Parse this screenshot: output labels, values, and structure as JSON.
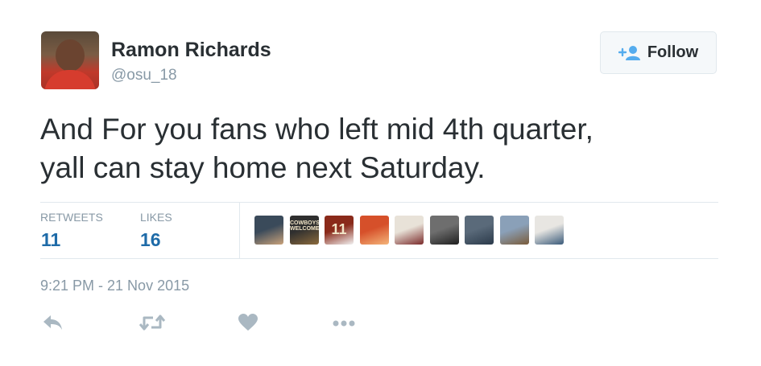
{
  "user": {
    "name": "Ramon Richards",
    "handle": "@osu_18"
  },
  "follow_button": {
    "label": "Follow"
  },
  "tweet": {
    "text_line1": "And For you fans who left mid 4th quarter,",
    "text_line2": "yall can stay home next Saturday."
  },
  "stats": {
    "retweets_label": "RETWEETS",
    "retweets_value": "11",
    "likes_label": "LIKES",
    "likes_value": "16"
  },
  "likers": [
    {
      "name": "liker-avatar-1",
      "colors": [
        "#3a4a5a",
        "#c9a27a"
      ]
    },
    {
      "name": "liker-avatar-2",
      "colors": [
        "#2f2f2f",
        "#8b6a3c"
      ],
      "text": "COWBOYS WELCOME"
    },
    {
      "name": "liker-avatar-3",
      "colors": [
        "#8a2a1a",
        "#f2f2f2"
      ],
      "text": "11"
    },
    {
      "name": "liker-avatar-4",
      "colors": [
        "#d6502a",
        "#f4b57a"
      ]
    },
    {
      "name": "liker-avatar-5",
      "colors": [
        "#e8e2d8",
        "#7a2a2a"
      ]
    },
    {
      "name": "liker-avatar-6",
      "colors": [
        "#6e6e6e",
        "#1f1f1f"
      ]
    },
    {
      "name": "liker-avatar-7",
      "colors": [
        "#5a6a7a",
        "#2b3a4a"
      ]
    },
    {
      "name": "liker-avatar-8",
      "colors": [
        "#8aa0b8",
        "#7a5c3a"
      ]
    },
    {
      "name": "liker-avatar-9",
      "colors": [
        "#e8e6e2",
        "#3a5a7a"
      ]
    }
  ],
  "timestamp": "9:21 PM - 21 Nov 2015",
  "icons": {
    "reply": "reply-icon",
    "retweet": "retweet-icon",
    "like": "heart-icon",
    "more": "more-icon"
  },
  "colors": {
    "text": "#292f33",
    "muted": "#8899a6",
    "stat_value": "#1e6ba8",
    "action_icon": "#aab8c2",
    "follow_icon": "#55acee",
    "border": "#e1e8ed"
  }
}
